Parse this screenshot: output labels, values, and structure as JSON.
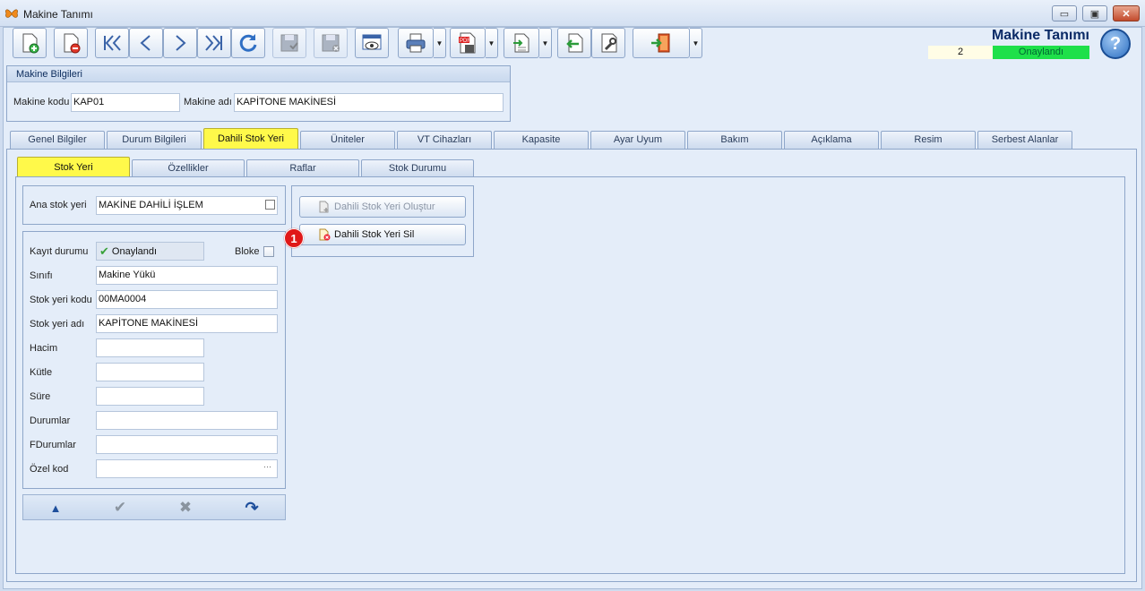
{
  "window": {
    "title": "Makine Tanımı",
    "minimize_glyph": "▭",
    "restore_glyph": "▣",
    "close_glyph": "✕"
  },
  "toolbar": {
    "buttons": [
      {
        "icon": "new-record-icon"
      },
      {
        "icon": "delete-record-icon"
      },
      {
        "icon": "first-record-icon"
      },
      {
        "icon": "previous-record-icon"
      },
      {
        "icon": "next-record-icon"
      },
      {
        "icon": "last-record-icon"
      },
      {
        "icon": "refresh-icon"
      },
      {
        "icon": "save-icon",
        "disabled": true
      },
      {
        "icon": "save-cancel-icon",
        "disabled": true
      },
      {
        "icon": "preview-icon"
      },
      {
        "icon": "print-icon"
      },
      {
        "icon": "pdf-export-icon"
      },
      {
        "icon": "import-icon"
      },
      {
        "icon": "back-icon"
      },
      {
        "icon": "tools-icon"
      },
      {
        "icon": "exit-door-icon"
      }
    ],
    "dropdown_glyph": "▼"
  },
  "header": {
    "form_title": "Makine Tanımı",
    "record_number": "2",
    "status": "Onaylandı",
    "help_glyph": "?"
  },
  "machine_info": {
    "title": "Makine Bilgileri",
    "code_label": "Makine kodu",
    "code_value": "KAP01",
    "name_label": "Makine adı",
    "name_value": "KAPİTONE MAKİNESİ"
  },
  "tabs": [
    {
      "label": "Genel Bilgiler",
      "active": false
    },
    {
      "label": "Durum Bilgileri",
      "active": false
    },
    {
      "label": "Dahili Stok Yeri",
      "active": true
    },
    {
      "label": "Üniteler",
      "active": false
    },
    {
      "label": "VT Cihazları",
      "active": false
    },
    {
      "label": "Kapasite",
      "active": false
    },
    {
      "label": "Ayar Uyum",
      "active": false
    },
    {
      "label": "Bakım",
      "active": false
    },
    {
      "label": "Açıklama",
      "active": false
    },
    {
      "label": "Resim",
      "active": false
    },
    {
      "label": "Serbest Alanlar",
      "active": false
    }
  ],
  "subtabs": [
    {
      "label": "Stok Yeri",
      "active": true
    },
    {
      "label": "Özellikler",
      "active": false
    },
    {
      "label": "Raflar",
      "active": false
    },
    {
      "label": "Stok Durumu",
      "active": false
    }
  ],
  "stock_location": {
    "main_label": "Ana stok yeri",
    "main_value": "MAKİNE DAHİLİ İŞLEM",
    "record_status_label": "Kayıt durumu",
    "record_status_value": "Onaylandı",
    "bloke_label": "Bloke",
    "bloke_checked": false,
    "fields": [
      {
        "label": "Sınıfı",
        "value": ""
      },
      {
        "label": "Stok yeri kodu",
        "value": "00MA0004"
      },
      {
        "label": "Stok yeri adı",
        "value": "KAPİTONE MAKİNESİ"
      },
      {
        "label": "Hacim",
        "value": ""
      },
      {
        "label": "Kütle",
        "value": ""
      },
      {
        "label": "Süre",
        "value": ""
      },
      {
        "label": "Durumlar",
        "value": ""
      },
      {
        "label": "FDurumlar",
        "value": ""
      },
      {
        "label": "Özel kod",
        "value": ""
      }
    ],
    "class_value": "Makine Yükü",
    "special_code_glyph": "···"
  },
  "actions": {
    "create_label": "Dahili Stok Yeri Oluştur",
    "delete_label": "Dahili Stok Yeri Sil",
    "badge": "1"
  },
  "nav_bar": {
    "up_glyph": "▲",
    "confirm_glyph": "✔",
    "cancel_glyph": "✖",
    "redo_glyph": "↷"
  },
  "colors": {
    "active_tab": "#fff94a",
    "status_green": "#1ee04a",
    "badge_red": "#e01818",
    "title_blue": "#0a2a66"
  }
}
